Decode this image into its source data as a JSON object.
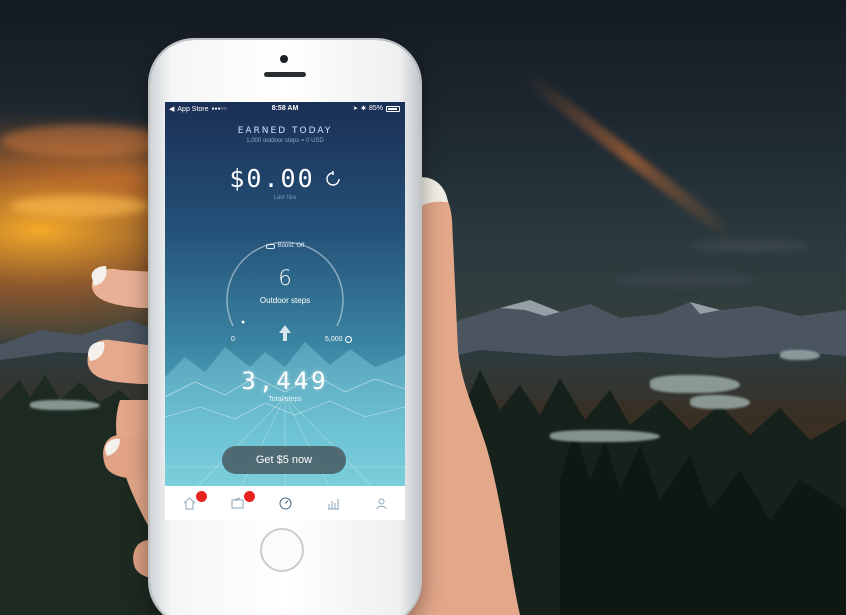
{
  "status_bar": {
    "carrier": "App Store",
    "signal": "●●●○○",
    "time": "8:58 AM",
    "battery_percent": "85%"
  },
  "earned": {
    "title": "EARNED TODAY",
    "subtitle": "1,000 outdoor steps = 0 USD",
    "amount": "$0.00",
    "amount_subtitle": "Last hire"
  },
  "gauge": {
    "boost_label": "Boost: Off",
    "outdoor_steps_value": "6",
    "outdoor_steps_label": "Outdoor steps",
    "scale_min": "0",
    "scale_max": "5,000",
    "progress_fraction": 0.0012
  },
  "total": {
    "value": "3,449",
    "label": "Total steps"
  },
  "cta": {
    "label": "Get $5 now"
  },
  "tabs": [
    {
      "icon": "home-icon",
      "badge": true
    },
    {
      "icon": "wallet-icon",
      "badge": true
    },
    {
      "icon": "speedometer-icon",
      "badge": false
    },
    {
      "icon": "stats-icon",
      "badge": false
    },
    {
      "icon": "profile-icon",
      "badge": false
    }
  ],
  "colors": {
    "accent_badge": "#e8231d",
    "screen_top": "#1b2f55",
    "screen_bottom": "#7ad2dc",
    "sunset": "#f0a030"
  }
}
